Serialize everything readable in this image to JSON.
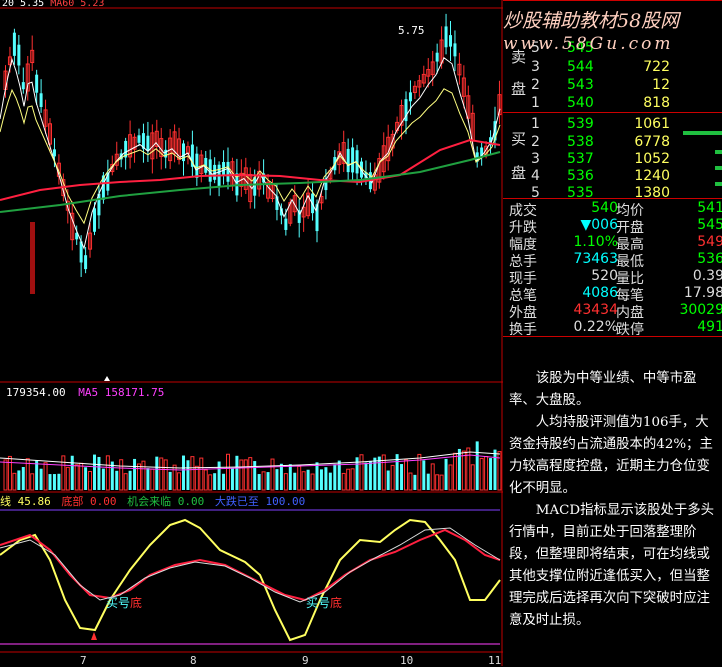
{
  "price_panel": {
    "indicator_header": "MA60 5.23",
    "high_marker": "5.75"
  },
  "volume_panel": {
    "volume_value": "179354.00",
    "ma_label": "MA5",
    "ma_value": "158171.75"
  },
  "indicator_panel": {
    "label_prefix": "线",
    "value1": "45.86",
    "label_dibu": "底部",
    "value2": "0.00",
    "label_jihui": "机会来临",
    "value3": "0.00",
    "label_daxian": "大跌已至",
    "value4": "100.00",
    "annotation_left": "买号",
    "annotation_left_red": "底",
    "annotation_right": "买号",
    "annotation_right_red": "底"
  },
  "date_axis": [
    "7",
    "8",
    "9",
    "10",
    "11"
  ],
  "watermark": {
    "line1": "炒股辅助教材58股网",
    "line2": "www.58Gu.com"
  },
  "order_book": {
    "sell_label_top": "卖",
    "sell_label_bottom": "盘",
    "buy_label_top": "买",
    "buy_label_bottom": "盘",
    "sell": [
      {
        "level": "5",
        "price": "545",
        "volume": ""
      },
      {
        "level": "3",
        "price": "544",
        "volume": "722"
      },
      {
        "level": "2",
        "price": "543",
        "volume": "12"
      },
      {
        "level": "1",
        "price": "540",
        "volume": "818"
      }
    ],
    "buy": [
      {
        "level": "1",
        "price": "539",
        "volume": "1061"
      },
      {
        "level": "2",
        "price": "538",
        "volume": "6778"
      },
      {
        "level": "3",
        "price": "537",
        "volume": "1052"
      },
      {
        "level": "4",
        "price": "536",
        "volume": "1240"
      },
      {
        "level": "5",
        "price": "535",
        "volume": "1380"
      }
    ]
  },
  "stats": [
    {
      "l1": "成交",
      "v1": "540",
      "l2": "均价",
      "v2": "541",
      "c1": "#00ff00",
      "c2": "#00ff00"
    },
    {
      "l1": "升跌",
      "v1": "▼006",
      "l2": "开盘",
      "v2": "545",
      "c1": "#00ffff",
      "c2": "#00ff00"
    },
    {
      "l1": "幅度",
      "v1": "1.10%",
      "l2": "最高",
      "v2": "549",
      "c1": "#00ff00",
      "c2": "#ff3030"
    },
    {
      "l1": "总手",
      "v1": "73463",
      "l2": "最低",
      "v2": "536",
      "c1": "#00ffff",
      "c2": "#00ff00"
    },
    {
      "l1": "现手",
      "v1": "520",
      "l2": "量比",
      "v2": "0.39",
      "c1": "#dddddd",
      "c2": "#dddddd"
    },
    {
      "l1": "总笔",
      "v1": "4086",
      "l2": "每笔",
      "v2": "17.98",
      "c1": "#00ffff",
      "c2": "#dddddd"
    },
    {
      "l1": "外盘",
      "v1": "43434",
      "l2": "内盘",
      "v2": "30029",
      "c1": "#ff3030",
      "c2": "#00ff00"
    },
    {
      "l1": "换手",
      "v1": "0.22%",
      "l2": "跌停",
      "v2": "491",
      "c1": "#dddddd",
      "c2": "#00ff00"
    }
  ],
  "analysis": [
    "该股为中等业绩、中等市盈率、大盘股。",
    "人均持股评测值为106手，大资金持股约占流通股本的42%；主力较高程度控盘，近期主力仓位变化不明显。",
    "MACD指标显示该股处于多头行情中，目前正处于回落整理阶段，但整理即将结束，可在均线或其他支撑位附近逢低买入，但当整理完成后选择再次向下突破时应注意及时止损。"
  ],
  "colors": {
    "up": "#ff3030",
    "down": "#54ffff",
    "ma_white": "#ffffff",
    "ma_red": "#ff2040",
    "ma_green": "#20a040",
    "yellow": "#ffff60",
    "panel_border": "#c00000"
  }
}
